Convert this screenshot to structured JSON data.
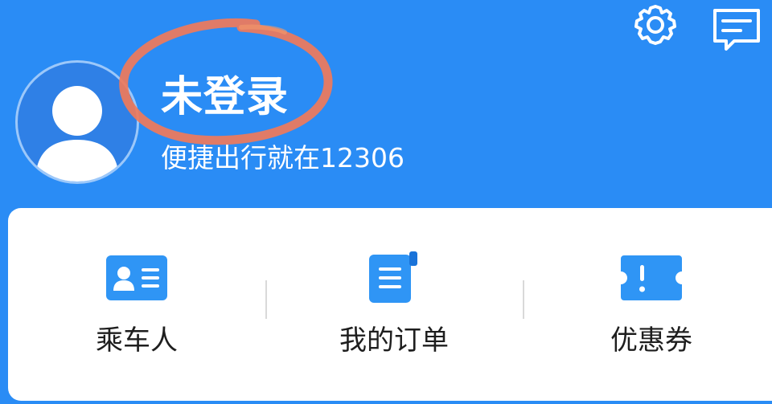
{
  "header": {
    "settings_icon": "gear-icon",
    "message_icon": "message-icon"
  },
  "user": {
    "name": "未登录",
    "subtitle": "便捷出行就在12306",
    "avatar_icon": "user-avatar-icon"
  },
  "menu": {
    "items": [
      {
        "label": "乘车人",
        "icon": "passenger-card-icon"
      },
      {
        "label": "我的订单",
        "icon": "order-document-icon"
      },
      {
        "label": "优惠券",
        "icon": "coupon-ticket-icon"
      }
    ]
  },
  "colors": {
    "background": "#2A8CF5",
    "card": "#FFFFFF",
    "annotation": "#F07A5A",
    "icon_blue": "#2F95F5"
  }
}
